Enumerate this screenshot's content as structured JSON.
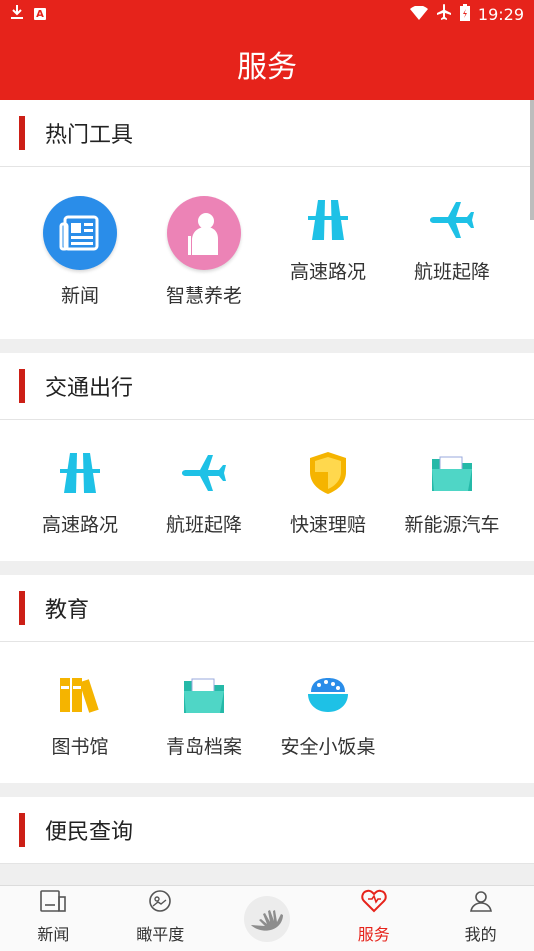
{
  "status_bar": {
    "time": "19:29",
    "left_icons": [
      "download-icon",
      "a-notification-icon"
    ],
    "right_icons": [
      "wifi-icon",
      "airplane-mode-icon",
      "battery-icon"
    ]
  },
  "title": "服务",
  "colors": {
    "brand": "#e6231b",
    "section_bar": "#cc1f16",
    "active_tab": "#e6231b"
  },
  "sections": [
    {
      "title": "热门工具",
      "items": [
        {
          "label": "新闻",
          "icon": "newspaper-icon"
        },
        {
          "label": "智慧养老",
          "icon": "elderly-icon"
        },
        {
          "label": "高速路况",
          "icon": "highway-icon"
        },
        {
          "label": "航班起降",
          "icon": "airplane-icon"
        }
      ]
    },
    {
      "title": "交通出行",
      "items": [
        {
          "label": "高速路况",
          "icon": "highway-icon"
        },
        {
          "label": "航班起降",
          "icon": "airplane-icon"
        },
        {
          "label": "快速理赔",
          "icon": "shield-icon"
        },
        {
          "label": "新能源汽车",
          "icon": "folder-icon"
        }
      ]
    },
    {
      "title": "教育",
      "items": [
        {
          "label": "图书馆",
          "icon": "books-icon"
        },
        {
          "label": "青岛档案",
          "icon": "folder-icon"
        },
        {
          "label": "安全小饭桌",
          "icon": "rice-bowl-icon"
        }
      ]
    },
    {
      "title": "便民查询",
      "items": []
    }
  ],
  "tabs": [
    {
      "label": "新闻",
      "icon": "news-tab-icon",
      "active": false
    },
    {
      "label": "瞰平度",
      "icon": "explore-tab-icon",
      "active": false
    },
    {
      "label": "",
      "icon": "hand-logo-icon",
      "active": false
    },
    {
      "label": "服务",
      "icon": "heart-tab-icon",
      "active": true
    },
    {
      "label": "我的",
      "icon": "profile-tab-icon",
      "active": false
    }
  ]
}
